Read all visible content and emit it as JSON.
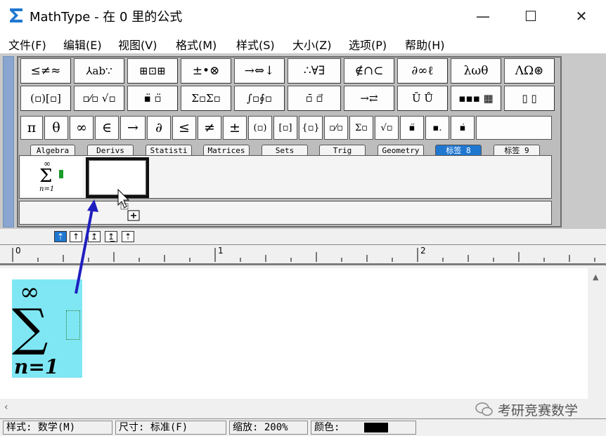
{
  "window": {
    "title": "MathType - 在 0 里的公式",
    "controls": [
      "—",
      "☐",
      "✕"
    ]
  },
  "menu": [
    "文件(F)",
    "编辑(E)",
    "视图(V)",
    "格式(M)",
    "样式(S)",
    "大小(Z)",
    "选项(P)",
    "帮助(H)"
  ],
  "palette": {
    "row1": [
      "≤≠≈",
      "⅄ab∵",
      "⊞⊡⊞",
      "±•⊗",
      "→⇔↓",
      "∴∀∃",
      "∉∩⊂",
      "∂∞ℓ",
      "λωθ",
      "ΛΩ⊛"
    ],
    "row2": [
      "(▫)[▫]",
      "▫⁄▫ √▫",
      "▪̈ ▫̈",
      "Σ▫Σ▫",
      "∫▫∮▫",
      "▫̄ ▫⃗",
      "→⇄",
      "Ū Ů",
      "▪▪▪ ▦",
      "▯ ▯"
    ],
    "row3": [
      "π",
      "θ",
      "∞",
      "∈",
      "→",
      "∂",
      "≤",
      "≠",
      "±",
      "(▫)",
      "[▫]",
      "{▫}",
      "▫⁄▫",
      "Σ▫",
      "√▫",
      "▪̈",
      "▪.",
      "▪̇"
    ],
    "tabs": [
      "Algebra",
      "Derivs",
      "Statisti",
      "Matrices",
      "Sets",
      "Trig",
      "Geometry",
      "标签 8",
      "标签 9"
    ],
    "active_tab": "标签 8",
    "template_sum": {
      "upper": "∞",
      "symbol": "Σ",
      "lower": "n=1"
    }
  },
  "nudge_buttons": [
    "⇡",
    "↑",
    "↥",
    "↥̲",
    "⇡"
  ],
  "ruler": {
    "labels": [
      "0",
      "1",
      "2"
    ]
  },
  "equation": {
    "upper": "∞",
    "symbol": "∑",
    "lower": "n=1"
  },
  "status": {
    "style": "样式: 数学(M)",
    "size": "尺寸: 标准(F)",
    "zoom": "缩放: 200%",
    "color_label": "颜色:",
    "color_value": "#000000"
  },
  "watermark": "考研竞赛数学",
  "colors": {
    "accent": "#1f77d0",
    "highlight": "#7fe7f4",
    "arrow": "#1f1fbf"
  }
}
